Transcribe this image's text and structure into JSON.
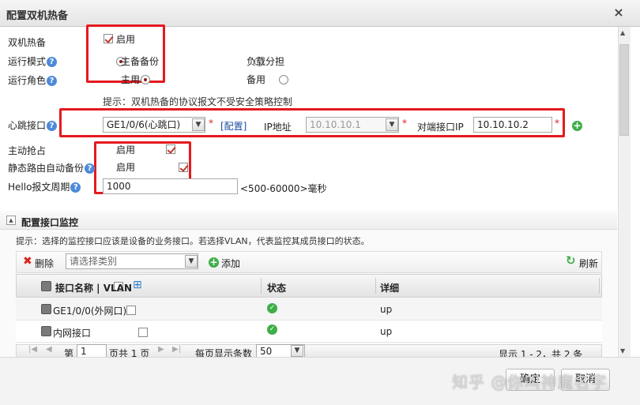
{
  "dialog": {
    "title": "配置双机热备",
    "close_symbol": "×"
  },
  "colors": {
    "accent_red": "#e5191e",
    "help_blue": "#4d8ad9",
    "ok_green": "#3fae49",
    "link_blue": "#1a4ea0"
  },
  "form": {
    "ha_label": "双机热备",
    "ha_enable_label": "启用",
    "mode_label": "运行模式",
    "mode_option_active": "主备备份",
    "mode_option_balance": "负载分担",
    "role_label": "运行角色",
    "role_option_master": "主用",
    "role_option_backup": "备用",
    "hint": "提示：双机热备的协议报文不受安全策略控制",
    "heartbeat_label": "心跳接口",
    "heartbeat_value": "GE1/0/6(心跳口)",
    "configure_link": "[配置]",
    "ip_label": "IP地址",
    "ip_value": "10.10.10.1",
    "peer_ip_label": "对端接口IP",
    "peer_ip_value": "10.10.10.2",
    "preempt_label": "主动抢占",
    "preempt_enable_label": "启用",
    "static_route_label": "静态路由自动备份",
    "static_route_enable_label": "启用",
    "hello_label": "Hello报文周期",
    "hello_value": "1000",
    "hello_range": "<500-60000>毫秒",
    "help_symbol": "?",
    "required_mark": "*"
  },
  "monitor": {
    "section_title": "配置接口监控",
    "hint": "提示：选择的监控接口应该是设备的业务接口。若选择VLAN，代表监控其成员接口的状态。",
    "delete_label": "删除",
    "category_placeholder": "请选择类别",
    "add_label": "添加",
    "refresh_label": "刷新",
    "columns": {
      "name": "接口名称 | VLAN",
      "status": "状态",
      "detail": "详细"
    },
    "rows": [
      {
        "name": "GE1/0/0(外网口)",
        "detail": "up"
      },
      {
        "name": "内网接口",
        "detail": "up"
      }
    ],
    "pager": {
      "page_prefix": "第",
      "page_value": "1",
      "page_suffix": "页共 1 页",
      "per_page_label": "每页显示条数",
      "per_page_value": "50",
      "summary": "显示 1 - 2，共 2 条"
    }
  },
  "footer": {
    "ok_label": "确定",
    "cancel_label": "取消"
  },
  "watermark": "知乎 @你叫神魔名字"
}
